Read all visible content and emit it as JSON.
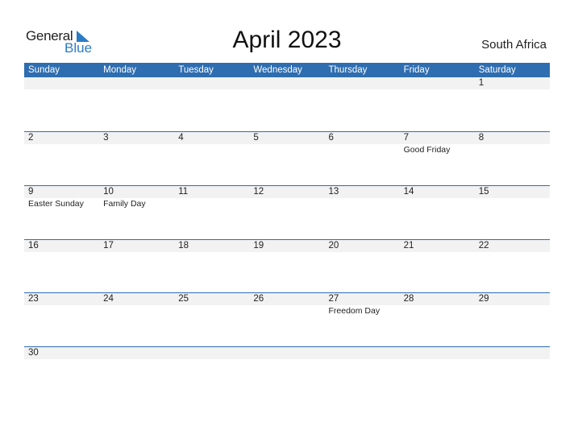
{
  "logo": {
    "word1": "General",
    "word2": "Blue"
  },
  "title": "April 2023",
  "country": "South Africa",
  "colors": {
    "header": "#2E6DB0",
    "strip": "#F2F2F2",
    "logo_blue": "#2B7BC4"
  },
  "weekdays": [
    "Sunday",
    "Monday",
    "Tuesday",
    "Wednesday",
    "Thursday",
    "Friday",
    "Saturday"
  ],
  "weeks": [
    [
      {
        "d": ""
      },
      {
        "d": ""
      },
      {
        "d": ""
      },
      {
        "d": ""
      },
      {
        "d": ""
      },
      {
        "d": ""
      },
      {
        "d": "1"
      }
    ],
    [
      {
        "d": "2"
      },
      {
        "d": "3"
      },
      {
        "d": "4"
      },
      {
        "d": "5"
      },
      {
        "d": "6"
      },
      {
        "d": "7",
        "h": "Good Friday"
      },
      {
        "d": "8"
      }
    ],
    [
      {
        "d": "9",
        "h": "Easter Sunday"
      },
      {
        "d": "10",
        "h": "Family Day"
      },
      {
        "d": "11"
      },
      {
        "d": "12"
      },
      {
        "d": "13"
      },
      {
        "d": "14"
      },
      {
        "d": "15"
      }
    ],
    [
      {
        "d": "16"
      },
      {
        "d": "17"
      },
      {
        "d": "18"
      },
      {
        "d": "19"
      },
      {
        "d": "20"
      },
      {
        "d": "21"
      },
      {
        "d": "22"
      }
    ],
    [
      {
        "d": "23"
      },
      {
        "d": "24"
      },
      {
        "d": "25"
      },
      {
        "d": "26"
      },
      {
        "d": "27",
        "h": "Freedom Day"
      },
      {
        "d": "28"
      },
      {
        "d": "29"
      }
    ],
    [
      {
        "d": "30"
      },
      {
        "d": ""
      },
      {
        "d": ""
      },
      {
        "d": ""
      },
      {
        "d": ""
      },
      {
        "d": ""
      },
      {
        "d": ""
      }
    ]
  ]
}
